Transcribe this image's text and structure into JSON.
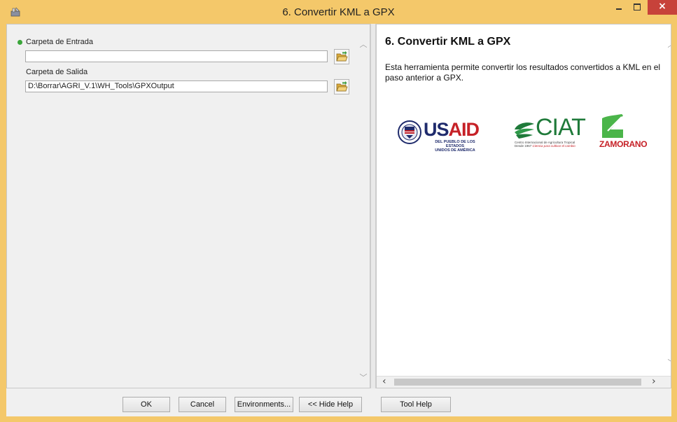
{
  "window": {
    "title": "6. Convertir KML a GPX",
    "controls": {
      "close_glyph": "×"
    }
  },
  "params": {
    "input_folder": {
      "label": "Carpeta de Entrada",
      "value": "",
      "required": true
    },
    "output_folder": {
      "label": "Carpeta de Salida",
      "value": "D:\\Borrar\\AGRI_V.1\\WH_Tools\\GPXOutput"
    }
  },
  "help": {
    "title": "6. Convertir KML a GPX",
    "body": "Esta herramienta permite convertir los resultados convertidos a KML en el paso anterior a GPX.",
    "logos": {
      "usaid": {
        "word_a": "US",
        "word_b": "AID",
        "sub1": "DEL PUEBLO DE LOS ESTADOS",
        "sub2": "UNIDOS DE AMÉRICA"
      },
      "ciat": {
        "word": "CIAT",
        "sub1": "Centro Internacional de Agricultura Tropical",
        "sub2_a": "Desde 1967 ",
        "sub2_b": "Ciencia para cultivar el cambio"
      },
      "zamorano": {
        "word": "ZAMORANO"
      }
    }
  },
  "buttons": {
    "ok": "OK",
    "cancel": "Cancel",
    "environments": "Environments...",
    "hide_help": "<< Hide Help",
    "tool_help": "Tool Help"
  },
  "icons": {
    "app": "toolbox-icon",
    "folder": "open-folder-icon",
    "minimize": "minimize-icon",
    "maximize": "maximize-icon",
    "close": "close-icon"
  },
  "colors": {
    "title_bar": "#f4c86a",
    "close_button": "#c7423a",
    "required_dot": "#3aa63a",
    "usaid_blue": "#1f2b6c",
    "usaid_red": "#c62127",
    "ciat_green": "#1f7a3a",
    "zamorano_red": "#c62127",
    "zamorano_green": "#4bb54a"
  }
}
